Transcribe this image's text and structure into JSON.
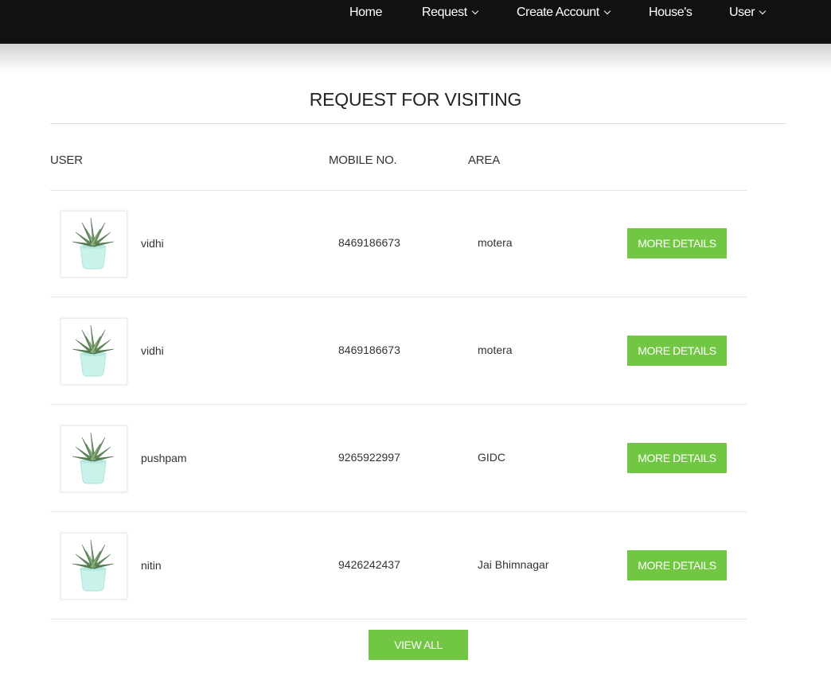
{
  "nav": {
    "items": [
      {
        "label": "Home",
        "dropdown": false
      },
      {
        "label": "Request",
        "dropdown": true
      },
      {
        "label": "Create Account",
        "dropdown": true
      },
      {
        "label": "House's",
        "dropdown": false
      },
      {
        "label": "User",
        "dropdown": true
      }
    ]
  },
  "page": {
    "title": "REQUEST FOR VISITING"
  },
  "table": {
    "headers": {
      "user": "USER",
      "mobile": "MOBILE NO.",
      "area": "AREA"
    },
    "rows": [
      {
        "user": "vidhi",
        "mobile": "8469186673",
        "area": "motera",
        "button": "MORE DETAILS",
        "image_icon": "potted-plant-icon"
      },
      {
        "user": "vidhi",
        "mobile": "8469186673",
        "area": "motera",
        "button": "MORE DETAILS",
        "image_icon": "potted-plant-icon"
      },
      {
        "user": "pushpam",
        "mobile": "9265922997",
        "area": "GIDC",
        "button": "MORE DETAILS",
        "image_icon": "potted-plant-icon"
      },
      {
        "user": "nitin",
        "mobile": "9426242437",
        "area": "Jai Bhimnagar",
        "button": "MORE DETAILS",
        "image_icon": "potted-plant-icon"
      }
    ]
  },
  "view_all": "VIEW ALL",
  "colors": {
    "nav_bg": "#111111",
    "accent": "#71c644",
    "text": "#333333"
  }
}
